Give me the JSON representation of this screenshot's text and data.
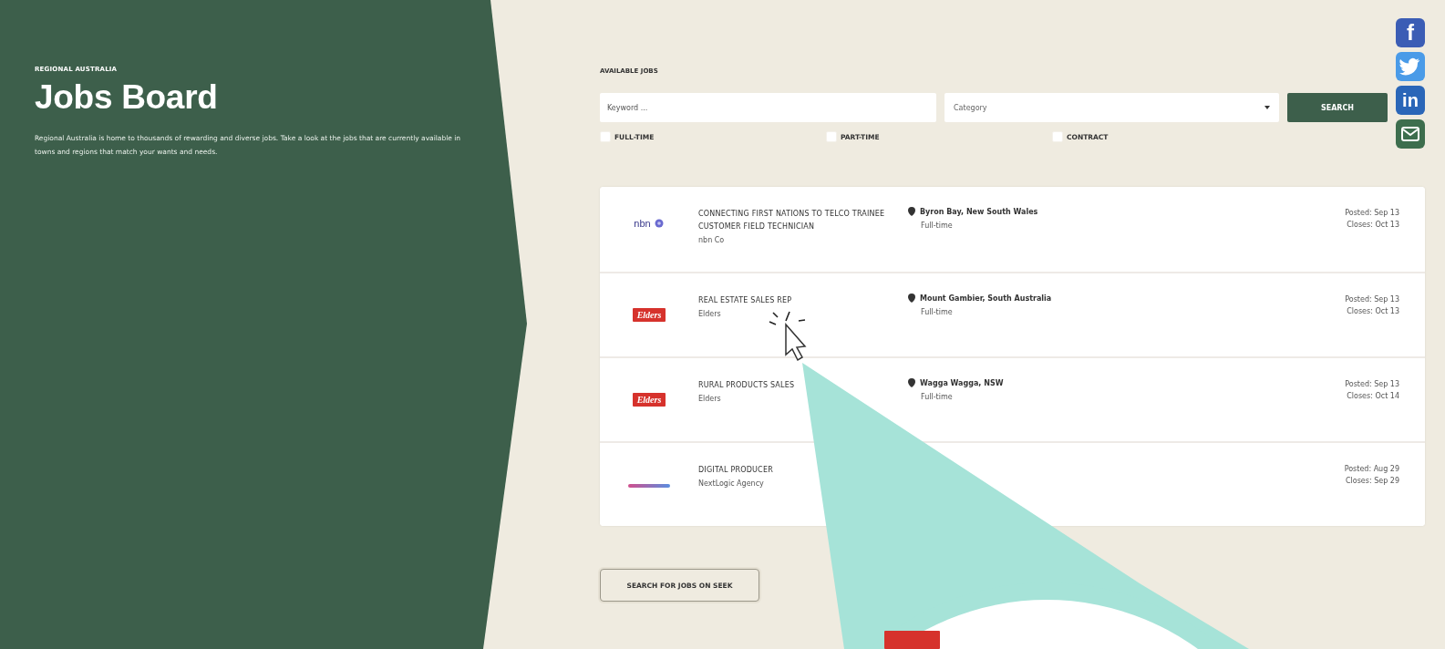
{
  "sidebar": {
    "eyebrow": "REGIONAL AUSTRALIA",
    "title": "Jobs Board",
    "intro": "Regional Australia is home to thousands of rewarding and diverse jobs. Take a look at the jobs that are currently available in towns and regions that match your wants and needs."
  },
  "search": {
    "heading": "AVAILABLE JOBS",
    "keyword": {
      "placeholder": "Keyword ..."
    },
    "category": {
      "placeholder": "Category"
    },
    "button": "SEARCH",
    "filters": [
      {
        "label": "FULL-TIME",
        "checked": false
      },
      {
        "label": "PART-TIME",
        "checked": false
      },
      {
        "label": "CONTRACT",
        "checked": false
      }
    ]
  },
  "social": [
    {
      "kind": "facebook",
      "glyph": "f"
    },
    {
      "kind": "twitter"
    },
    {
      "kind": "linkedin",
      "glyph": "in"
    },
    {
      "kind": "email"
    }
  ],
  "jobs": [
    {
      "logo": {
        "kind": "nbn",
        "text": "nbn"
      },
      "title": "CONNECTING FIRST NATIONS TO TELCO TRAINEE CUSTOMER FIELD TECHNICIAN",
      "company": "nbn Co",
      "location": "Byron Bay, New South Wales",
      "type": "Full-time",
      "posted": "Posted: Sep 13",
      "closes": "Closes: Oct 13"
    },
    {
      "logo": {
        "kind": "elders",
        "text": "Elders"
      },
      "title": "REAL ESTATE SALES REP",
      "company": "Elders",
      "location": "Mount Gambier, South Australia",
      "type": "Full-time",
      "posted": "Posted: Sep 13",
      "closes": "Closes: Oct 13"
    },
    {
      "logo": {
        "kind": "elders",
        "text": "Elders"
      },
      "title": "RURAL PRODUCTS SALES",
      "company": "Elders",
      "location": "Wagga Wagga, NSW",
      "type": "Full-time",
      "posted": "Posted: Sep 13",
      "closes": "Closes: Oct 14"
    },
    {
      "logo": {
        "kind": "bar"
      },
      "title": "DIGITAL PRODUCER",
      "company": "NextLogic Agency",
      "posted": "Posted: Aug 29",
      "closes": "Closes: Sep 29"
    }
  ],
  "seek_button": "SEARCH FOR JOBS ON SEEK"
}
